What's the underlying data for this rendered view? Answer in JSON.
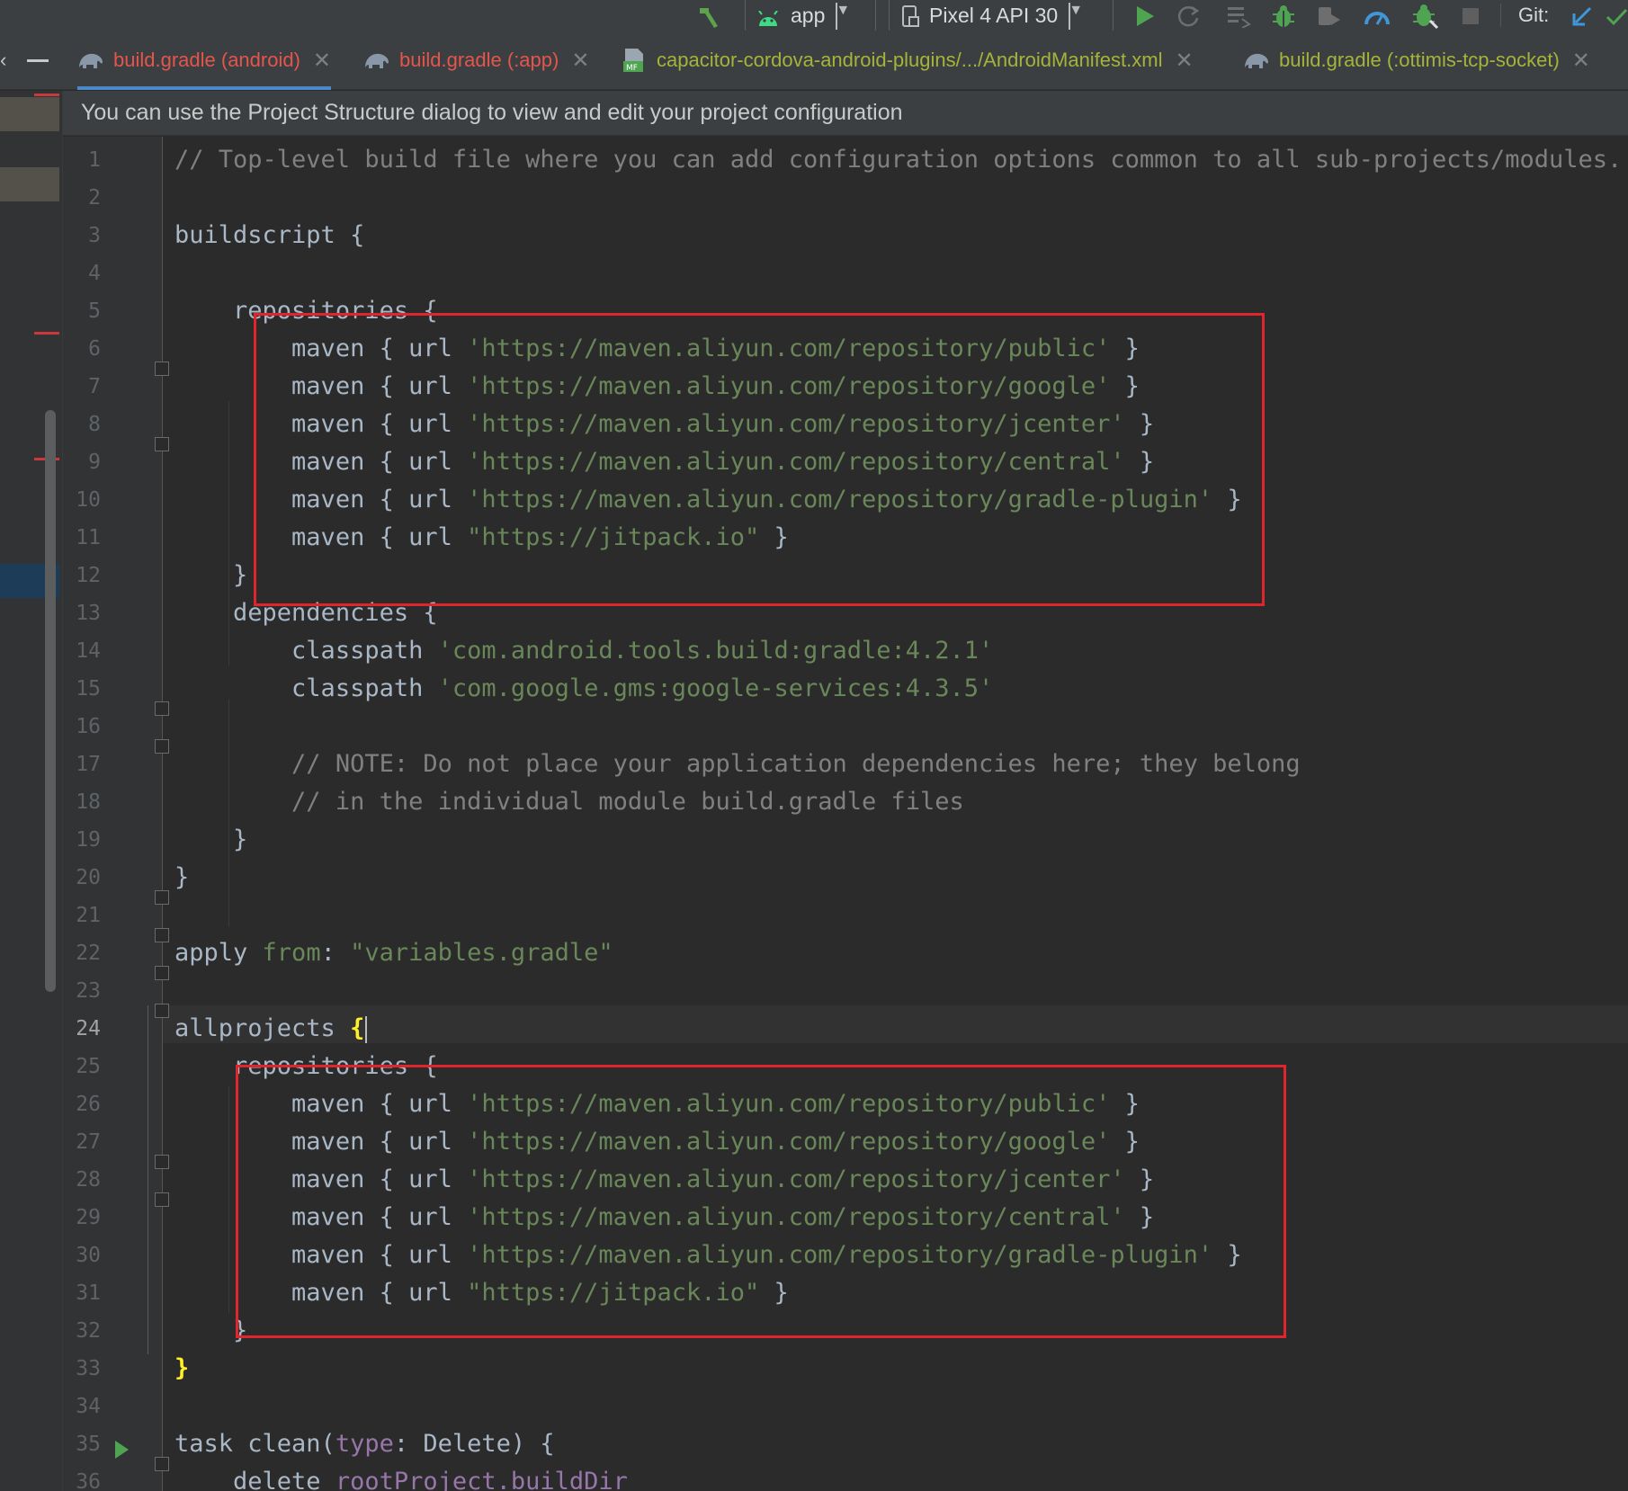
{
  "toolbar": {
    "run_config": "app",
    "device": "Pixel 4 API 30",
    "git_label": "Git:"
  },
  "tabs": [
    {
      "label": "build.gradle (android)",
      "icon": "gradle-elephant-icon",
      "color": "#e4554c",
      "active": true
    },
    {
      "label": "build.gradle (:app)",
      "icon": "gradle-elephant-icon",
      "color": "#e4554c",
      "active": false
    },
    {
      "label": "capacitor-cordova-android-plugins/.../AndroidManifest.xml",
      "icon": "manifest-file-icon",
      "color": "#a5b33a",
      "active": false
    },
    {
      "label": "build.gradle (:ottimis-tcp-socket)",
      "icon": "gradle-elephant-icon",
      "color": "#a5b33a",
      "active": false
    }
  ],
  "banner": {
    "text": "You can use the Project Structure dialog to view and edit your project configuration"
  },
  "editor": {
    "current_line": 24,
    "line_numbers": [
      "1",
      "2",
      "3",
      "4",
      "5",
      "6",
      "7",
      "8",
      "9",
      "10",
      "11",
      "12",
      "13",
      "14",
      "15",
      "16",
      "17",
      "18",
      "19",
      "20",
      "21",
      "22",
      "23",
      "24",
      "25",
      "26",
      "27",
      "28",
      "29",
      "30",
      "31",
      "32",
      "33",
      "34",
      "35",
      "36"
    ],
    "lines": [
      {
        "n": 1,
        "indent": 0,
        "parts": [
          {
            "t": "// Top-level build file where you can add configuration options common to all sub-projects/modules.",
            "c": "com"
          }
        ]
      },
      {
        "n": 2,
        "indent": 0,
        "parts": []
      },
      {
        "n": 3,
        "indent": 0,
        "parts": [
          {
            "t": "buildscript {",
            "c": ""
          }
        ]
      },
      {
        "n": 4,
        "indent": 0,
        "parts": []
      },
      {
        "n": 5,
        "indent": 1,
        "parts": [
          {
            "t": "repositories {",
            "c": ""
          }
        ]
      },
      {
        "n": 6,
        "indent": 2,
        "parts": [
          {
            "t": "maven { url ",
            "c": ""
          },
          {
            "t": "'https://maven.aliyun.com/repository/public'",
            "c": "str"
          },
          {
            "t": " }",
            "c": ""
          }
        ]
      },
      {
        "n": 7,
        "indent": 2,
        "parts": [
          {
            "t": "maven { url ",
            "c": ""
          },
          {
            "t": "'https://maven.aliyun.com/repository/google'",
            "c": "str"
          },
          {
            "t": " }",
            "c": ""
          }
        ]
      },
      {
        "n": 8,
        "indent": 2,
        "parts": [
          {
            "t": "maven { url ",
            "c": ""
          },
          {
            "t": "'https://maven.aliyun.com/repository/jcenter'",
            "c": "str"
          },
          {
            "t": " }",
            "c": ""
          }
        ]
      },
      {
        "n": 9,
        "indent": 2,
        "parts": [
          {
            "t": "maven { url ",
            "c": ""
          },
          {
            "t": "'https://maven.aliyun.com/repository/central'",
            "c": "str"
          },
          {
            "t": " }",
            "c": ""
          }
        ]
      },
      {
        "n": 10,
        "indent": 2,
        "parts": [
          {
            "t": "maven { url ",
            "c": ""
          },
          {
            "t": "'https://maven.aliyun.com/repository/gradle-plugin'",
            "c": "str"
          },
          {
            "t": " }",
            "c": ""
          }
        ]
      },
      {
        "n": 11,
        "indent": 2,
        "parts": [
          {
            "t": "maven { url ",
            "c": ""
          },
          {
            "t": "\"https://jitpack.io\"",
            "c": "str"
          },
          {
            "t": " }",
            "c": ""
          }
        ]
      },
      {
        "n": 12,
        "indent": 1,
        "parts": [
          {
            "t": "}",
            "c": ""
          }
        ]
      },
      {
        "n": 13,
        "indent": 1,
        "parts": [
          {
            "t": "dependencies {",
            "c": ""
          }
        ]
      },
      {
        "n": 14,
        "indent": 2,
        "parts": [
          {
            "t": "classpath ",
            "c": ""
          },
          {
            "t": "'com.android.tools.build:gradle:4.2.1'",
            "c": "str"
          }
        ]
      },
      {
        "n": 15,
        "indent": 2,
        "parts": [
          {
            "t": "classpath ",
            "c": ""
          },
          {
            "t": "'com.google.gms:google-services:4.3.5'",
            "c": "str"
          }
        ]
      },
      {
        "n": 16,
        "indent": 0,
        "parts": []
      },
      {
        "n": 17,
        "indent": 2,
        "parts": [
          {
            "t": "// NOTE: Do not place your application dependencies here; they belong",
            "c": "com"
          }
        ]
      },
      {
        "n": 18,
        "indent": 2,
        "parts": [
          {
            "t": "// in the individual module build.gradle files",
            "c": "com"
          }
        ]
      },
      {
        "n": 19,
        "indent": 1,
        "parts": [
          {
            "t": "}",
            "c": ""
          }
        ]
      },
      {
        "n": 20,
        "indent": 0,
        "parts": [
          {
            "t": "}",
            "c": ""
          }
        ]
      },
      {
        "n": 21,
        "indent": 0,
        "parts": []
      },
      {
        "n": 22,
        "indent": 0,
        "parts": [
          {
            "t": "apply ",
            "c": ""
          },
          {
            "t": "from",
            "c": "str"
          },
          {
            "t": ": ",
            "c": ""
          },
          {
            "t": "\"variables.gradle\"",
            "c": "str"
          }
        ]
      },
      {
        "n": 23,
        "indent": 0,
        "parts": []
      },
      {
        "n": 24,
        "indent": 0,
        "parts": [
          {
            "t": "allprojects ",
            "c": ""
          },
          {
            "t": "{",
            "c": "hl"
          },
          {
            "t": "",
            "c": "caret"
          }
        ]
      },
      {
        "n": 25,
        "indent": 1,
        "parts": [
          {
            "t": "repositories {",
            "c": ""
          }
        ]
      },
      {
        "n": 26,
        "indent": 2,
        "parts": [
          {
            "t": "maven { url ",
            "c": ""
          },
          {
            "t": "'https://maven.aliyun.com/repository/public'",
            "c": "str"
          },
          {
            "t": " }",
            "c": ""
          }
        ]
      },
      {
        "n": 27,
        "indent": 2,
        "parts": [
          {
            "t": "maven { url ",
            "c": ""
          },
          {
            "t": "'https://maven.aliyun.com/repository/google'",
            "c": "str"
          },
          {
            "t": " }",
            "c": ""
          }
        ]
      },
      {
        "n": 28,
        "indent": 2,
        "parts": [
          {
            "t": "maven { url ",
            "c": ""
          },
          {
            "t": "'https://maven.aliyun.com/repository/jcenter'",
            "c": "str"
          },
          {
            "t": " }",
            "c": ""
          }
        ]
      },
      {
        "n": 29,
        "indent": 2,
        "parts": [
          {
            "t": "maven { url ",
            "c": ""
          },
          {
            "t": "'https://maven.aliyun.com/repository/central'",
            "c": "str"
          },
          {
            "t": " }",
            "c": ""
          }
        ]
      },
      {
        "n": 30,
        "indent": 2,
        "parts": [
          {
            "t": "maven { url ",
            "c": ""
          },
          {
            "t": "'https://maven.aliyun.com/repository/gradle-plugin'",
            "c": "str"
          },
          {
            "t": " }",
            "c": ""
          }
        ]
      },
      {
        "n": 31,
        "indent": 2,
        "parts": [
          {
            "t": "maven { url ",
            "c": ""
          },
          {
            "t": "\"https://jitpack.io\"",
            "c": "str"
          },
          {
            "t": " }",
            "c": ""
          }
        ]
      },
      {
        "n": 32,
        "indent": 1,
        "parts": [
          {
            "t": "}",
            "c": ""
          }
        ]
      },
      {
        "n": 33,
        "indent": 0,
        "parts": [
          {
            "t": "}",
            "c": "hl"
          }
        ]
      },
      {
        "n": 34,
        "indent": 0,
        "parts": []
      },
      {
        "n": 35,
        "indent": 0,
        "parts": [
          {
            "t": "task clean(",
            "c": ""
          },
          {
            "t": "type",
            "c": "prop"
          },
          {
            "t": ": Delete) {",
            "c": ""
          }
        ]
      },
      {
        "n": 36,
        "indent": 1,
        "parts": [
          {
            "t": "delete ",
            "c": ""
          },
          {
            "t": "rootProject.buildDir",
            "c": "prop"
          }
        ]
      }
    ]
  },
  "colors": {
    "accent": "#4a88c7",
    "annotation_box": "#e0252c",
    "string": "#6a8759",
    "comment": "#808080",
    "brace_match": "#ffef28"
  }
}
